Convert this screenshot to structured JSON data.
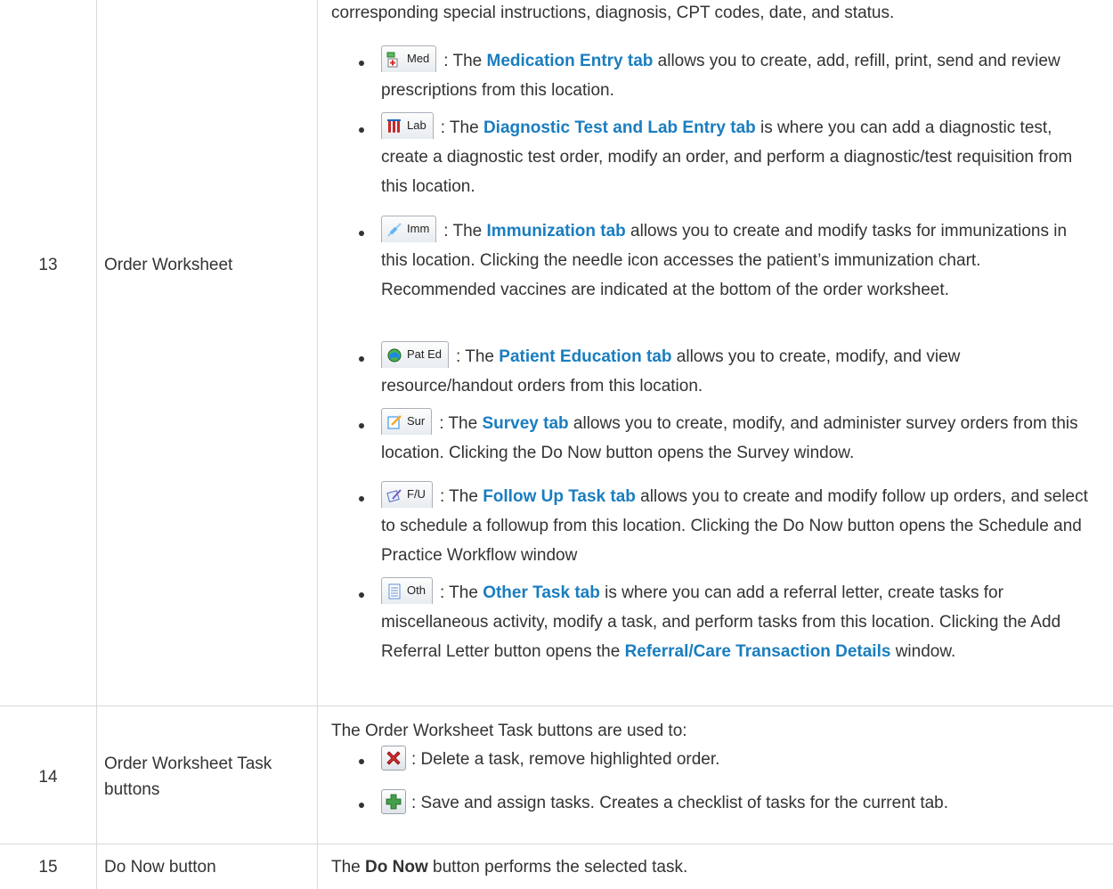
{
  "rows": [
    {
      "number": "13",
      "name": "Order Worksheet",
      "intro": "corresponding special instructions, diagnosis, CPT codes, date, and status.",
      "items": [
        {
          "tab_label": "Med",
          "icon": "medication-icon",
          "pre": ": The ",
          "link": "Medication Entry tab",
          "post": " allows you to create, add, refill, print, send and review prescriptions from this location."
        },
        {
          "tab_label": "Lab",
          "icon": "lab-tubes-icon",
          "pre": ": The ",
          "link": "Diagnostic Test and Lab Entry tab",
          "post": " is where you can add a diagnostic test, create a diagnostic test order, modify an order, and perform a diagnostic/test requisition from this location."
        },
        {
          "tab_label": "Imm",
          "icon": "needle-icon",
          "pre": ": The ",
          "link": "Immunization tab",
          "post": " allows you to create and modify tasks for immunizations in this location.  Clicking the needle icon accesses the patient’s immunization chart.   Recommended vaccines are indicated at the bottom of the order worksheet."
        },
        {
          "tab_label": "Pat Ed",
          "icon": "patient-education-icon",
          "pre": ": The ",
          "link": "Patient Education tab",
          "post": " allows you to create, modify, and view resource/handout orders from this location."
        },
        {
          "tab_label": "Sur",
          "icon": "survey-icon",
          "pre": ": The ",
          "link": "Survey tab",
          "post": " allows you to create, modify, and administer survey orders from this location.  Clicking the Do Now button opens the Survey window."
        },
        {
          "tab_label": "F/U",
          "icon": "follow-up-icon",
          "pre": ": The ",
          "link": "Follow Up Task tab",
          "post": " allows you to create and modify follow up orders, and select to schedule a followup from this location.  Clicking the Do Now button opens the Schedule and Practice Workflow window"
        },
        {
          "tab_label": "Oth",
          "icon": "other-task-icon",
          "pre": ": The ",
          "link": "Other Task tab",
          "post_1": " is where you can add a referral letter, create tasks for miscellaneous activity, modify a task, and perform tasks from this location.  Clicking the Add Referral Letter button opens the ",
          "link_2": "Referral/Care Transaction Details",
          "post_2": " window."
        }
      ]
    },
    {
      "number": "14",
      "name": "Order Worksheet Task buttons",
      "intro": "The Order Worksheet Task buttons are used to:",
      "items": [
        {
          "icon": "delete-x-icon",
          "text": ": Delete a task, remove highlighted order."
        },
        {
          "icon": "add-plus-icon",
          "text": ": Save and assign tasks.  Creates a checklist of tasks for the current tab."
        }
      ]
    },
    {
      "number": "15",
      "name": "Do Now button",
      "intro_pre": "The ",
      "intro_bold": "Do Now",
      "intro_post": " button performs the selected task."
    }
  ],
  "colors": {
    "link": "#1a7dbf",
    "text": "#333333",
    "border": "#d8d8d8"
  }
}
